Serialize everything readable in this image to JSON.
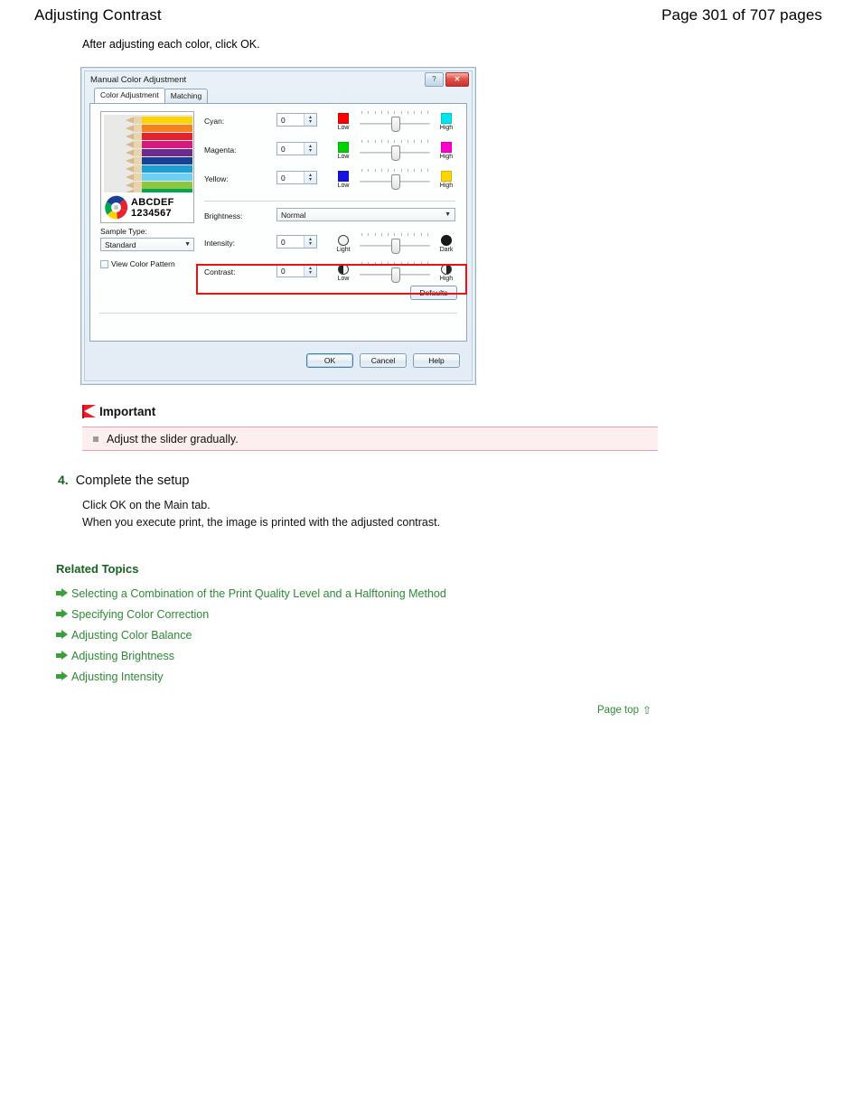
{
  "header": {
    "doc_title": "Adjusting Contrast",
    "page_count": "Page 301 of 707 pages"
  },
  "intro": "After adjusting each color, click OK.",
  "dialog": {
    "title": "Manual Color Adjustment",
    "window_buttons": [
      {
        "name": "help-button",
        "glyph": "?"
      },
      {
        "name": "close-button",
        "glyph": "✕"
      }
    ],
    "tabs": [
      {
        "label": "Color Adjustment",
        "active": true
      },
      {
        "label": "Matching",
        "active": false
      }
    ],
    "preview": {
      "text_line_1": "ABCDEF",
      "text_line_2": "1234567"
    },
    "sample_type": {
      "label": "Sample Type:",
      "value": "Standard"
    },
    "view_color_pattern": {
      "label": "View Color Pattern",
      "checked": false
    },
    "color_rows": [
      {
        "name": "cyan",
        "label": "Cyan:",
        "mnemonic": "C",
        "value": "0",
        "low_label": "Low",
        "high_label": "High",
        "low_color": "#ff0000",
        "high_color": "#00e5f0",
        "endcap_style": "swatch"
      },
      {
        "name": "magenta",
        "label": "Magenta:",
        "mnemonic": "M",
        "value": "0",
        "low_label": "Low",
        "high_label": "High",
        "low_color": "#00d400",
        "high_color": "#ff00d0",
        "endcap_style": "swatch"
      },
      {
        "name": "yellow",
        "label": "Yellow:",
        "mnemonic": "Y",
        "value": "0",
        "low_label": "Low",
        "high_label": "High",
        "low_color": "#1414e0",
        "high_color": "#ffd400",
        "endcap_style": "swatch"
      }
    ],
    "brightness": {
      "label": "Brightness:",
      "mnemonic": "B",
      "value": "Normal"
    },
    "intensity": {
      "label": "Intensity:",
      "mnemonic": "I",
      "value": "0",
      "low_label": "Light",
      "high_label": "Dark",
      "endcap_style": "circle",
      "low_fill": "white",
      "high_fill": "black"
    },
    "contrast": {
      "label": "Contrast:",
      "mnemonic": "n",
      "value": "0",
      "low_label": "Low",
      "high_label": "High",
      "endcap_style": "circle",
      "low_fill": "half",
      "high_fill": "half-r",
      "highlighted": true,
      "highlight_color": "#ee1111"
    },
    "defaults_label": "Defaults",
    "footer_buttons": [
      {
        "label": "OK",
        "primary": true
      },
      {
        "label": "Cancel",
        "primary": false
      },
      {
        "label": "Help",
        "primary": false
      }
    ]
  },
  "important": {
    "title": "Important",
    "items": [
      "Adjust the slider gradually."
    ]
  },
  "step": {
    "number": "4.",
    "title": "Complete the setup",
    "body_line_1": "Click OK on the Main tab.",
    "body_line_2": "When you execute print, the image is printed with the adjusted contrast."
  },
  "related": {
    "heading": "Related Topics",
    "links": [
      "Selecting a Combination of the Print Quality Level and a Halftoning Method",
      "Specifying Color Correction",
      "Adjusting Color Balance",
      "Adjusting Brightness",
      "Adjusting Intensity"
    ]
  },
  "page_top": {
    "label": "Page top",
    "icon": "up-arrow-icon",
    "glyph": "⇧"
  },
  "colors": {
    "link_green": "#2e8b35",
    "heading_green": "#17621f",
    "highlight_red": "#ee1111",
    "important_bg": "#fdeef0"
  }
}
